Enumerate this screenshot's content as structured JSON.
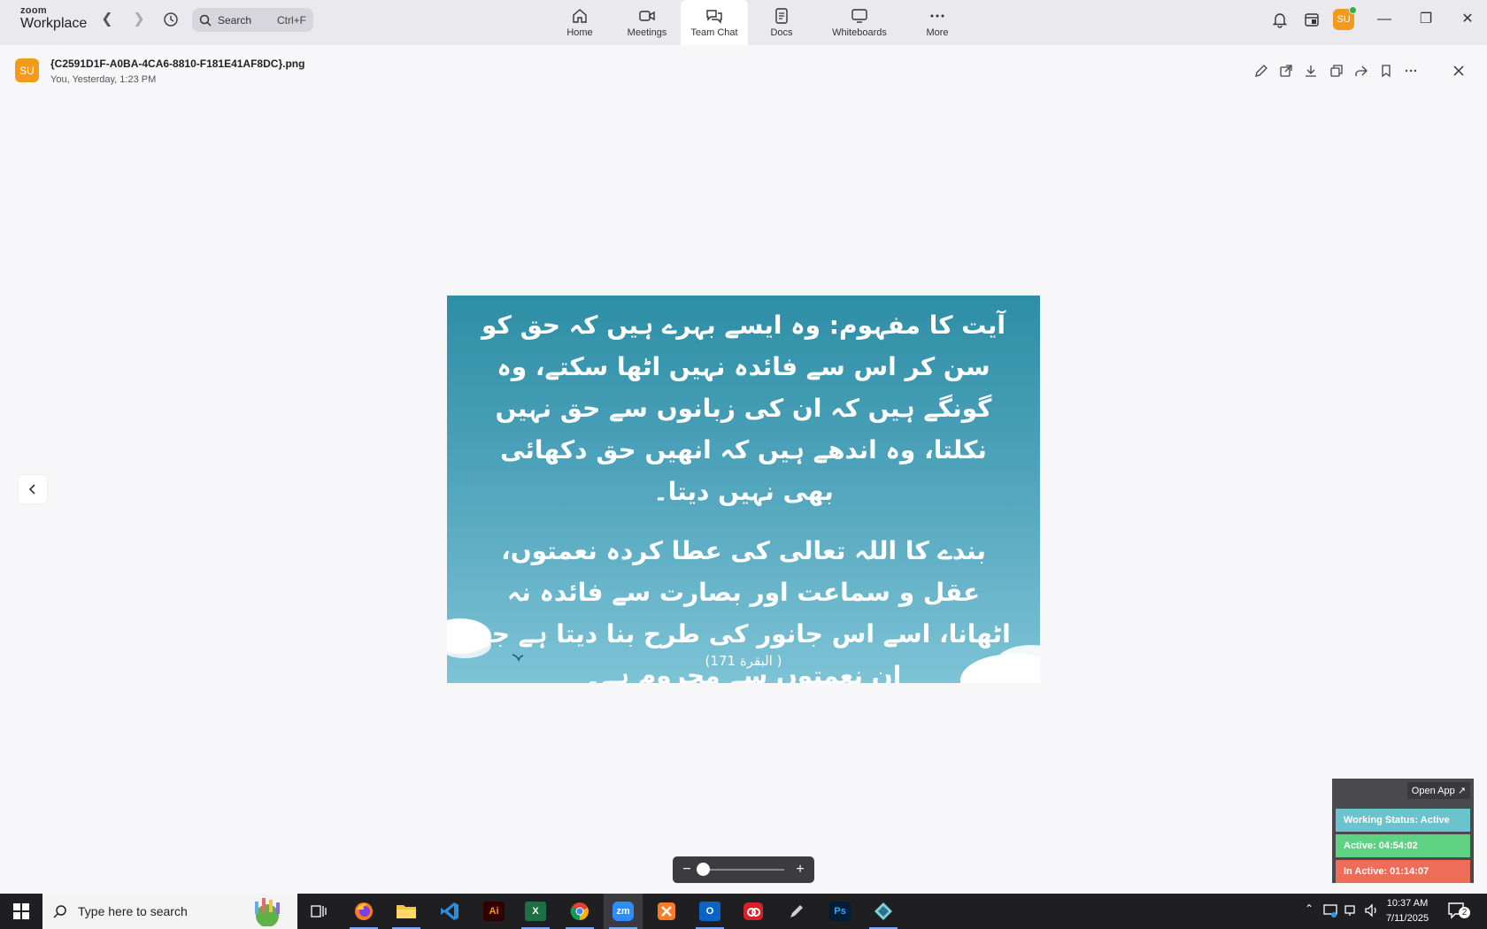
{
  "app": {
    "brand_small": "zoom",
    "brand_large": "Workplace"
  },
  "search": {
    "label": "Search",
    "shortcut": "Ctrl+F"
  },
  "tabs": [
    {
      "label": "Home",
      "icon": "home-icon"
    },
    {
      "label": "Meetings",
      "icon": "video-icon"
    },
    {
      "label": "Team Chat",
      "icon": "chat-icon",
      "active": true
    },
    {
      "label": "Docs",
      "icon": "docs-icon"
    },
    {
      "label": "Whiteboards",
      "icon": "whiteboard-icon"
    },
    {
      "label": "More",
      "icon": "more-icon"
    }
  ],
  "user": {
    "initials": "SU",
    "presence_color": "#2bb34a",
    "avatar_color": "#f39a1c"
  },
  "file": {
    "name": "{C2591D1F-A0BA-4CA6-8810-F181E41AF8DC}.png",
    "meta": "You, Yesterday, 1:23 PM",
    "avatar": "SU"
  },
  "image": {
    "paragraph1": "آیت کا مفہوم: وہ ایسے بہرے ہیں کہ حق کو سن کر اس سے فائدہ نہیں اٹھا سکتے، وہ گونگے ہیں کہ ان کی زبانوں سے حق نہیں نکلتا، وہ اندھے ہیں کہ انھیں حق دکھائی بھی نہیں دیتا۔",
    "paragraph2": "بندے کا اللہ تعالی کی عطا کردہ نعمتوں، عقل و سماعت اور بصارت سے فائدہ نہ اٹھانا، اسے اس جانور کی طرح بنا دیتا ہے جو ان نعمتوں سے محروم ہے۔",
    "reference": "( البقرة 171)"
  },
  "zoom_control": {
    "minus": "−",
    "plus": "+",
    "level_fraction": 0
  },
  "status_widget": {
    "open_app": "Open App ↗",
    "working": "Working Status: Active",
    "active": "Active: 04:54:02",
    "inactive": "In Active: 01:14:07",
    "colors": {
      "working": "#6bc3ce",
      "active": "#5fd183",
      "inactive": "#ed6c5a"
    }
  },
  "taskbar": {
    "search_placeholder": "Type here to search",
    "apps": [
      {
        "name": "task-view",
        "label": ""
      },
      {
        "name": "firefox",
        "label": ""
      },
      {
        "name": "file-explorer",
        "label": ""
      },
      {
        "name": "vscode",
        "label": ""
      },
      {
        "name": "illustrator",
        "label": "Ai"
      },
      {
        "name": "excel",
        "label": "X"
      },
      {
        "name": "chrome",
        "label": ""
      },
      {
        "name": "zoom",
        "label": "zm"
      },
      {
        "name": "xampp",
        "label": ""
      },
      {
        "name": "outlook",
        "label": "O"
      },
      {
        "name": "creative-cloud",
        "label": ""
      },
      {
        "name": "pen-tool",
        "label": ""
      },
      {
        "name": "photoshop",
        "label": "Ps"
      },
      {
        "name": "app-diamond",
        "label": ""
      }
    ],
    "clock_time": "10:37 AM",
    "clock_date": "7/11/2025",
    "notification_count": "2"
  }
}
